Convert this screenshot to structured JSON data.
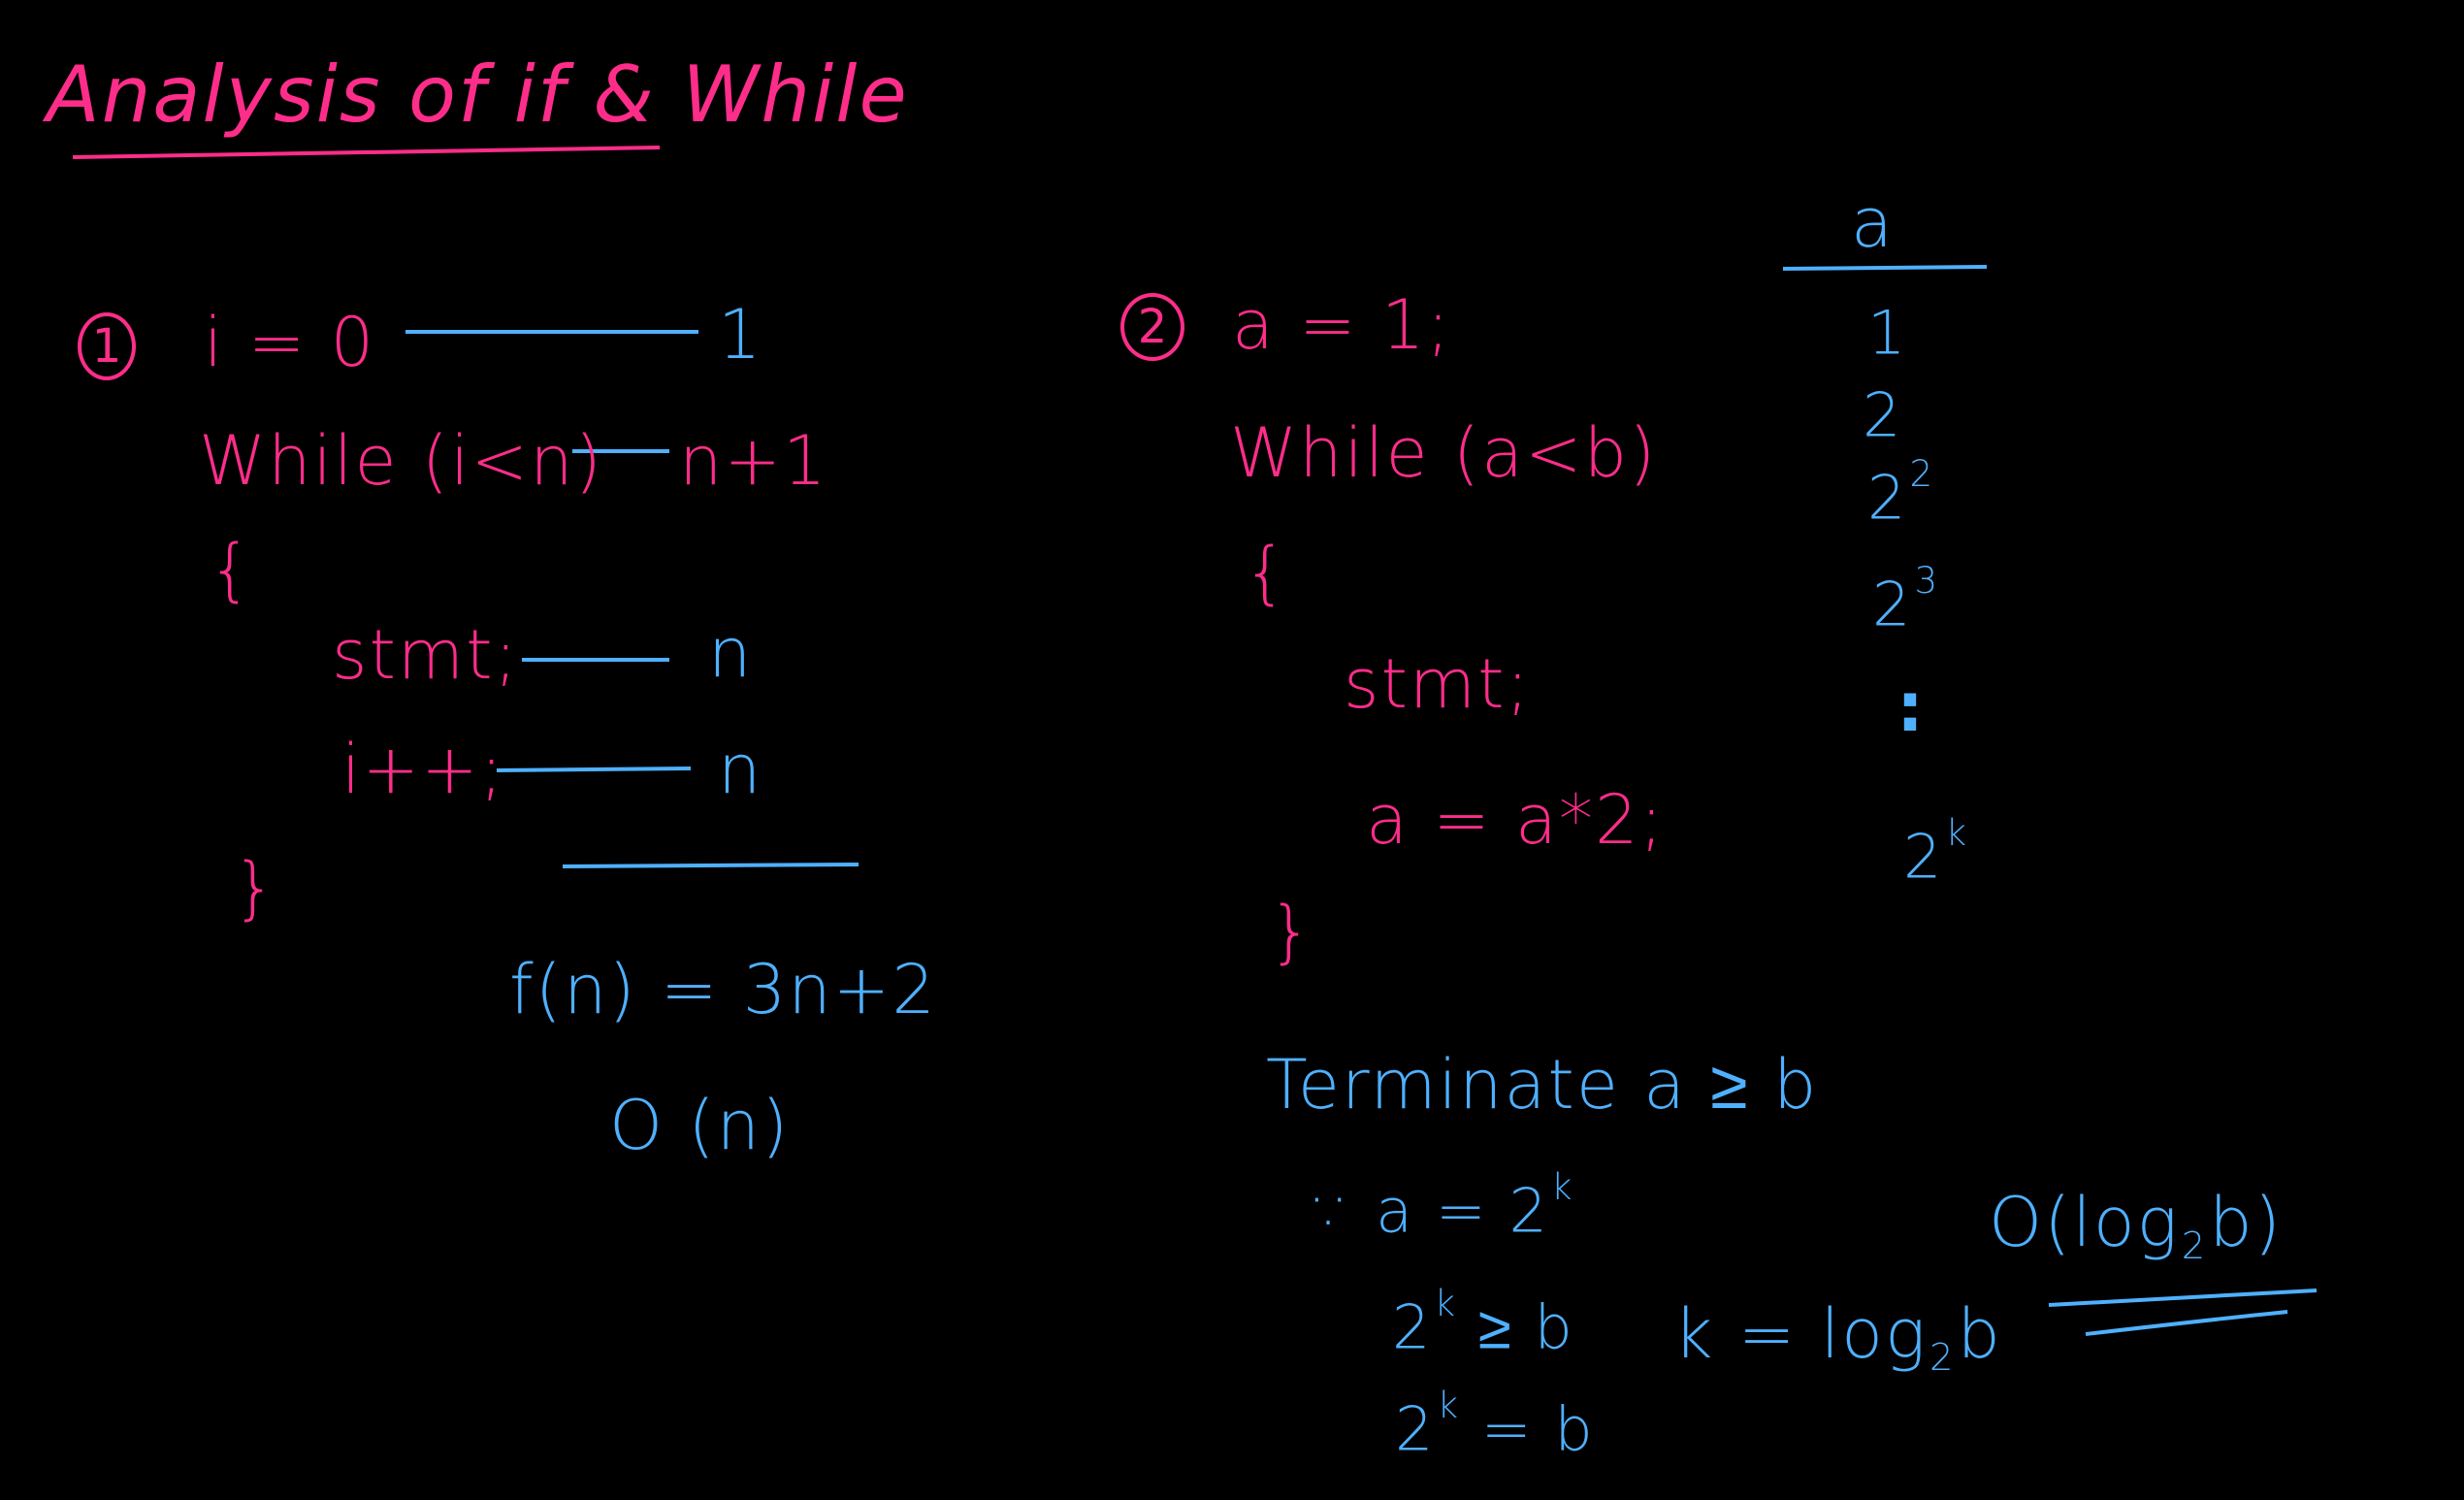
{
  "title": "Analysis of if & While",
  "colors": {
    "code": "#ff2d8a",
    "annotation": "#4fb0ff",
    "background": "#000000"
  },
  "example1": {
    "number": "1",
    "line1": "i = 0",
    "line1_count": "1",
    "line2": "While (i<n)",
    "line2_count": "n+1",
    "open_brace": "{",
    "line3": "stmt;",
    "line3_count": "n",
    "line4": "i++;",
    "line4_count": "n",
    "close_brace": "}",
    "fn": "f(n) = 3n+2",
    "order": "O (n)"
  },
  "example2": {
    "number": "2",
    "line1": "a = 1;",
    "line2": "While (a<b)",
    "open_brace": "{",
    "line3": "stmt;",
    "line4": "a = a*2;",
    "close_brace": "}",
    "terminate": "Terminate   a ≥ b",
    "since_prefix": "∵ a = 2",
    "since_exp": "k",
    "ineq_base": "2",
    "ineq_exp": "k",
    "ineq_rest": " ≥ b",
    "eq_base": "2",
    "eq_exp": "k",
    "eq_rest": " = b",
    "k_prefix": "k = log",
    "k_sub": "2",
    "k_suffix": "b",
    "order_prefix": "O(log",
    "order_sub": "2",
    "order_suffix": "b)"
  },
  "table": {
    "header": "a",
    "rows": [
      {
        "base": "1",
        "exp": ""
      },
      {
        "base": "2",
        "exp": ""
      },
      {
        "base": "2",
        "exp": "2"
      },
      {
        "base": "2",
        "exp": "3"
      },
      {
        "base": ":",
        "exp": ""
      },
      {
        "base": "2",
        "exp": "k"
      }
    ]
  }
}
